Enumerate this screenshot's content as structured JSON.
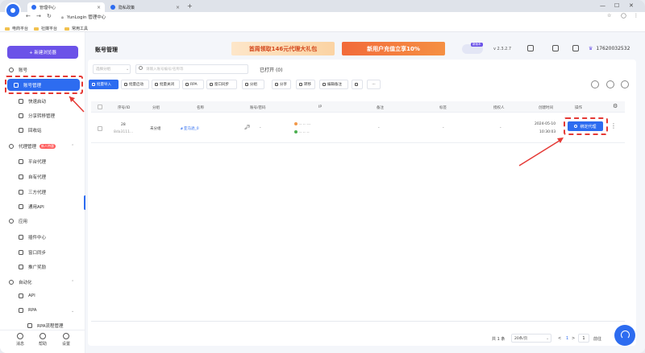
{
  "browser": {
    "tabs": [
      {
        "label": "管理中心",
        "active": true
      },
      {
        "label": "隐私政策",
        "active": false
      }
    ],
    "new_tab": "+",
    "url": "YunLogin 管理中心",
    "bookmarks": [
      "电商平台",
      "社媒平台",
      "常用工具"
    ]
  },
  "sidebar": {
    "new_button": "+ 新建浏览器",
    "sections": [
      {
        "label": "账号",
        "items": [
          "账号管理",
          "快速启动",
          "分享转移管理",
          "回收站"
        ]
      },
      {
        "label": "代理管理",
        "badge": "新人特惠",
        "items": [
          "平台代理",
          "自有代理",
          "三方代理",
          "通用API"
        ]
      },
      {
        "label": "应用",
        "items": [
          "插件中心",
          "窗口同步",
          "推广奖励"
        ]
      },
      {
        "label": "自动化",
        "items": [
          "API",
          "RPA",
          "RPA流程管理"
        ]
      }
    ],
    "bottom": [
      "消息",
      "帮助",
      "设置"
    ]
  },
  "header": {
    "title": "账号管理",
    "banner1": "首周领取146元代理大礼包",
    "banner2": "新用户充值立享10%",
    "cloud_tag": "新版本",
    "version": "v 2.3.2.7",
    "phone": "17620032532"
  },
  "filters": {
    "group_placeholder": "选择分组",
    "search_placeholder": "请输入账号编号/名称等",
    "opened_label": "已打开",
    "opened_count": "(0)"
  },
  "toolbar": [
    "批量导入",
    "批量启动",
    "批量关闭",
    "RPA",
    "窗口同步",
    "分组",
    "分享",
    "转移",
    "编辑备注",
    "",
    "···"
  ],
  "table": {
    "headers": [
      "序号/ID",
      "分组",
      "名称",
      "账号/密码",
      "IP",
      "备注",
      "标签",
      "授权人",
      "创建时间",
      "操作"
    ],
    "rows": [
      {
        "seq": "28",
        "id": "8da3111...",
        "group": "未分组",
        "name": "亚马逊_0",
        "account": "-",
        "ip_line1": "-- -- ---",
        "ip_line2": "-- -- --",
        "remark": "-",
        "tag": "-",
        "auth": "-",
        "date": "2024-05-10",
        "time": "10:30:03",
        "action": "绑定代理"
      }
    ]
  },
  "pagination": {
    "total": "共 1 条",
    "per_page": "20条/页",
    "prev": "<",
    "page": "1",
    "next": ">",
    "goto": "前往"
  }
}
